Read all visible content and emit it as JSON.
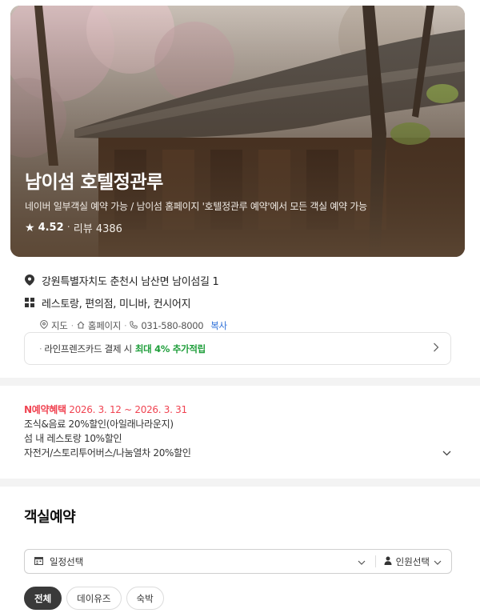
{
  "hero": {
    "title": "남이섬 호텔정관루",
    "subtitle": "네이버 일부객실 예약 가능 / 남이섬 홈페이지 '호텔정관루 예약'에서 모든 객실 예약 가능",
    "rating": "4.52",
    "review_label": "리뷰 4386",
    "star": "★"
  },
  "info": {
    "address": "강원특별자치도 춘천시 남산면 남이섬길 1",
    "facilities": "레스토랑, 편의점, 미니바, 컨시어지",
    "map_link": "지도",
    "homepage_link": "홈페이지",
    "phone": "031-580-8000",
    "copy_label": "복사"
  },
  "card_promo": {
    "text": "라인프렌즈카드 결제 시",
    "highlight": "최대 4% 추가적립"
  },
  "benefit": {
    "label": "N예약혜택",
    "period": "2026. 3. 12 ~ 2026. 3. 31",
    "lines": [
      "조식&음료 20%할인(아일래나라운지)",
      "섬 내 레스토랑 10%할인",
      "자전거/스토리투어버스/나눔열차 20%할인"
    ]
  },
  "reservation": {
    "title": "객실예약",
    "date_label": "일정선택",
    "guest_label": "인원선택",
    "chips": [
      "전체",
      "데이유즈",
      "숙박"
    ]
  },
  "colors": {
    "benefit_red": "#f04452",
    "card_green": "#1e9e3a",
    "copy_blue": "#2d6fd8"
  }
}
